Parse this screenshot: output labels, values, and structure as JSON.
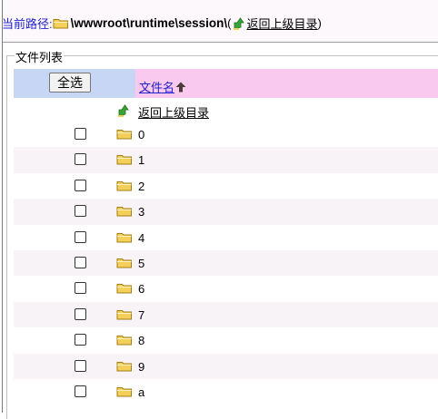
{
  "path": {
    "label": "当前路径:",
    "value": "\\wwwroot\\runtime\\session\\",
    "open_paren": "(",
    "back_link": "返回上级目录",
    "close_paren": ")"
  },
  "section": {
    "legend": "文件列表"
  },
  "table": {
    "select_all": "全选",
    "name_header": "文件名",
    "back_row": "返回上级目录",
    "rows": [
      {
        "name": "0"
      },
      {
        "name": "1"
      },
      {
        "name": "2"
      },
      {
        "name": "3"
      },
      {
        "name": "4"
      },
      {
        "name": "5"
      },
      {
        "name": "6"
      },
      {
        "name": "7"
      },
      {
        "name": "8"
      },
      {
        "name": "9"
      },
      {
        "name": "a"
      }
    ]
  },
  "colors": {
    "path_label": "#2222cc",
    "header_left": "#c7d6f4",
    "header_right": "#fac9f0",
    "row_alt": "#f7f3f7",
    "folder": "#f4cf5a",
    "up_arrow": "#3aa436"
  },
  "icons": {
    "folder": "folder-icon",
    "up": "up-directory-icon",
    "sort": "sort-arrow-up-icon"
  }
}
